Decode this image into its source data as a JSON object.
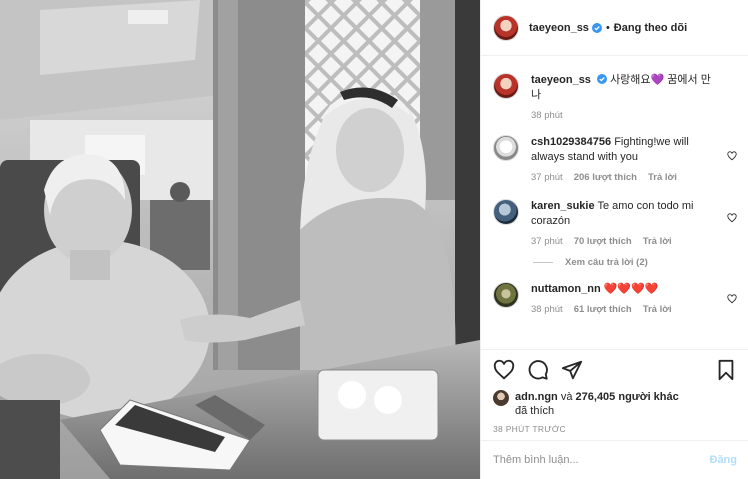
{
  "header": {
    "username": "taeyeon_ss",
    "separator": "•",
    "follow_status": "Đang theo dõi"
  },
  "caption": {
    "username": "taeyeon_ss",
    "text": "사랑해요💜 꿈에서 만나",
    "time": "38 phút"
  },
  "comments": [
    {
      "username": "csh1029384756",
      "text": "Fighting!we will always stand with you",
      "time": "37 phút",
      "likes": "206 lượt thích",
      "reply_label": "Trả lời",
      "avatar_icon": "profile-avatar-icon"
    },
    {
      "username": "karen_sukie",
      "text": "Te amo con todo mi corazón",
      "time": "37 phút",
      "likes": "70 lượt thích",
      "reply_label": "Trả lời",
      "view_replies": "Xem câu trả lời (2)",
      "avatar_icon": "profile-avatar-icon"
    },
    {
      "username": "nuttamon_nn",
      "text": "❤️❤️❤️❤️",
      "time": "38 phút",
      "likes": "61 lượt thích",
      "reply_label": "Trả lời",
      "avatar_icon": "profile-avatar-icon"
    }
  ],
  "actions": {
    "like_icon": "heart-icon",
    "comment_icon": "comment-icon",
    "share_icon": "share-icon",
    "save_icon": "bookmark-icon"
  },
  "likes": {
    "first_user": "adn.ngn",
    "connector": "và",
    "count": "276,405 người khác",
    "suffix": "đã thích"
  },
  "posted_ago": "38 PHÚT TRƯỚC",
  "add_comment": {
    "placeholder": "Thêm bình luận...",
    "post_label": "Đăng"
  },
  "colors": {
    "verified": "#3897f0",
    "post_disabled": "#b2dffc",
    "muted": "#8e8e8e",
    "text": "#262626"
  }
}
